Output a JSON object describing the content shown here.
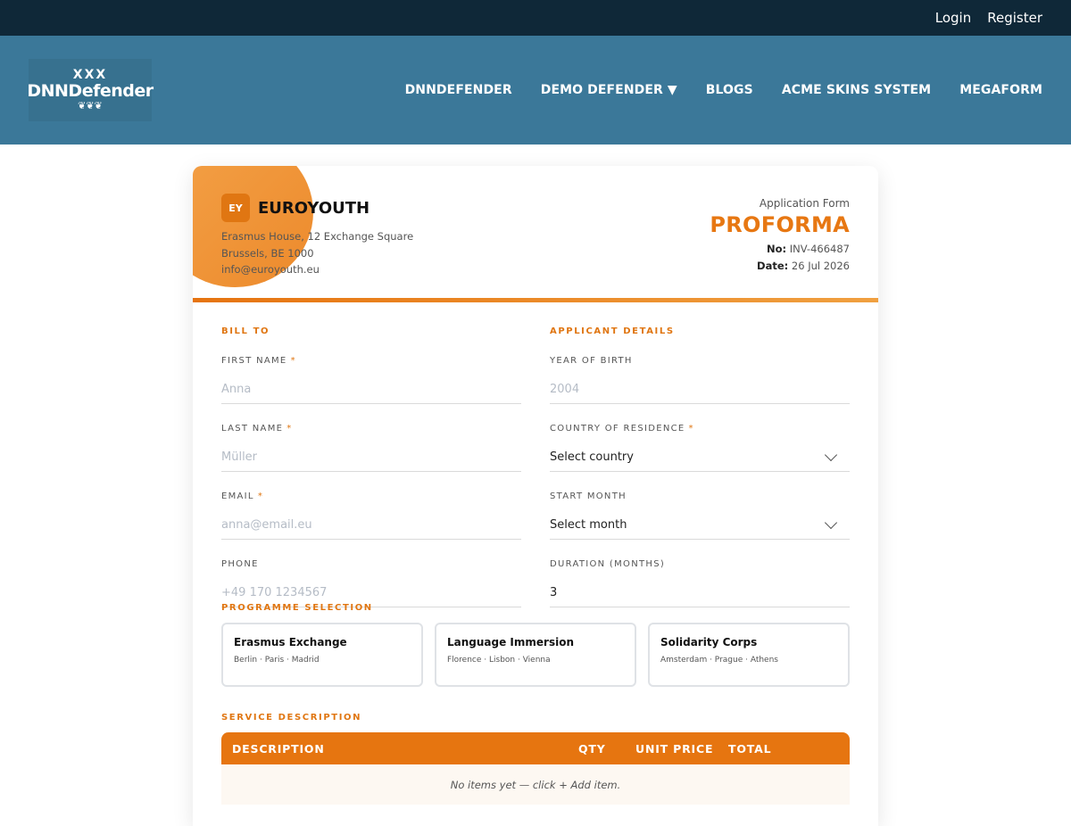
{
  "topbar": {
    "login": "Login",
    "register": "Register"
  },
  "logo": {
    "marks": "XXX",
    "name": "DNNDefender",
    "leaf": "❦❦❦"
  },
  "nav": [
    "DNNDEFENDER",
    "DEMO DEFENDER ▼",
    "BLOGS",
    "ACME SKINS SYSTEM",
    "MEGAFORM"
  ],
  "brand": {
    "badge": "EY",
    "name": "EUROYOUTH",
    "address_line1": "Erasmus House, 12 Exchange Square",
    "address_line2": "Brussels, BE 1000",
    "email": "info@euroyouth.eu"
  },
  "doc": {
    "label": "Application Form",
    "title": "PROFORMA",
    "no_label": "No:",
    "no_value": "INV-466487",
    "date_label": "Date:",
    "date_value": "26 Jul 2026"
  },
  "bill_to": {
    "title": "BILL TO",
    "first_name": {
      "label": "FIRST NAME",
      "required": "*",
      "placeholder": "Anna"
    },
    "last_name": {
      "label": "LAST NAME",
      "required": "*",
      "placeholder": "Müller"
    },
    "email": {
      "label": "EMAIL",
      "required": "*",
      "placeholder": "anna@email.eu"
    },
    "phone": {
      "label": "PHONE",
      "placeholder": "+49 170 1234567"
    }
  },
  "applicant": {
    "title": "APPLICANT DETAILS",
    "year_of_birth": {
      "label": "YEAR OF BIRTH",
      "placeholder": "2004"
    },
    "country": {
      "label": "COUNTRY OF RESIDENCE",
      "required": "*",
      "value": "Select country"
    },
    "start_month": {
      "label": "START MONTH",
      "value": "Select month"
    },
    "duration": {
      "label": "DURATION (MONTHS)",
      "value": "3"
    }
  },
  "programme": {
    "title": "PROGRAMME SELECTION",
    "options": [
      {
        "name": "Erasmus Exchange",
        "cities": "Berlin · Paris · Madrid"
      },
      {
        "name": "Language Immersion",
        "cities": "Florence · Lisbon · Vienna"
      },
      {
        "name": "Solidarity Corps",
        "cities": "Amsterdam · Prague · Athens"
      }
    ]
  },
  "service": {
    "title": "SERVICE DESCRIPTION",
    "headers": {
      "description": "DESCRIPTION",
      "qty": "QTY",
      "unit_price": "UNIT PRICE",
      "total": "TOTAL"
    },
    "empty": "No items yet — click + Add item."
  }
}
